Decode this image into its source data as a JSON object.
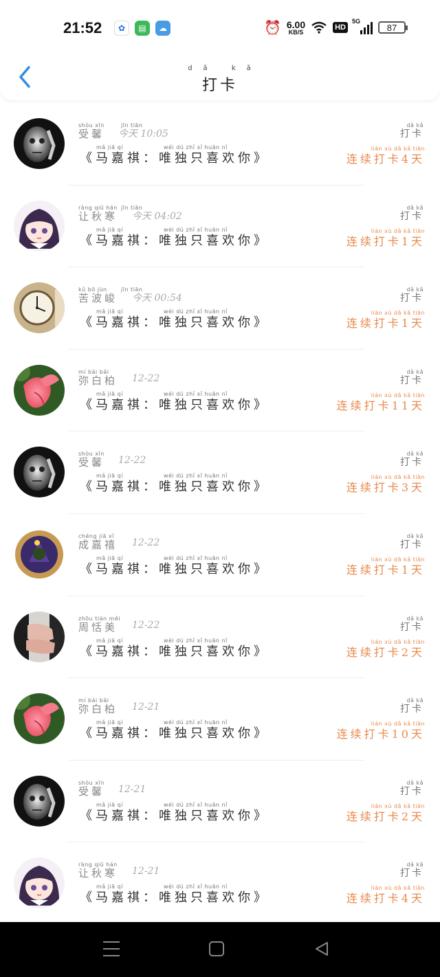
{
  "status_bar": {
    "time": "21:52",
    "net_speed_value": "6.00",
    "net_speed_unit": "KB/S",
    "hd": "HD",
    "network": "5G",
    "battery": "87"
  },
  "header": {
    "title": "打卡",
    "title_pinyin": "dǎ kǎ"
  },
  "labels": {
    "checkin_label": "打卡",
    "checkin_pinyin": "dǎ   kǎ",
    "post_pinyin_a": "mǎ  jiā  qí",
    "post_pinyin_b": "wéi  dú  zhǐ  xǐ  huān  nǐ",
    "streak_pinyin": "lián  xù  dǎ  kǎ  tiān"
  },
  "rows": [
    {
      "avatar": "skull-man",
      "name": "受馨",
      "name_pinyin": "shòu  xīn",
      "time": "今天 10:05",
      "time_pinyin": "jīn tiān",
      "post": "《马嘉祺：唯独只喜欢你》",
      "streak": "连续打卡4天"
    },
    {
      "avatar": "anime-girl",
      "name": "让秋寒",
      "name_pinyin": "ràng qiū hán",
      "time": "今天 04:02",
      "time_pinyin": "jīn tiān",
      "post": "《马嘉祺：唯独只喜欢你》",
      "streak": "连续打卡1天"
    },
    {
      "avatar": "clock",
      "name": "苦波峻",
      "name_pinyin": "kǔ  bō  jùn",
      "time": "今天 00:54",
      "time_pinyin": "jīn tiān",
      "post": "《马嘉祺：唯独只喜欢你》",
      "streak": "连续打卡1天"
    },
    {
      "avatar": "pink-flower",
      "name": "弥白柏",
      "name_pinyin": "mí  bái  bǎi",
      "time": "12-22",
      "time_pinyin": "",
      "post": "《马嘉祺：唯独只喜欢你》",
      "streak": "连续打卡11天"
    },
    {
      "avatar": "skull-man",
      "name": "受馨",
      "name_pinyin": "shòu  xīn",
      "time": "12-22",
      "time_pinyin": "",
      "post": "《马嘉祺：唯独只喜欢你》",
      "streak": "连续打卡3天"
    },
    {
      "avatar": "emblem",
      "name": "成嘉禧",
      "name_pinyin": "chéng jiā  xǐ",
      "time": "12-22",
      "time_pinyin": "",
      "post": "《马嘉祺：唯独只喜欢你》",
      "streak": "连续打卡1天"
    },
    {
      "avatar": "hand-photo",
      "name": "周恬美",
      "name_pinyin": "zhōu tián měi",
      "time": "12-22",
      "time_pinyin": "",
      "post": "《马嘉祺：唯独只喜欢你》",
      "streak": "连续打卡2天"
    },
    {
      "avatar": "pink-flower",
      "name": "弥白柏",
      "name_pinyin": "mí  bái  bǎi",
      "time": "12-21",
      "time_pinyin": "",
      "post": "《马嘉祺：唯独只喜欢你》",
      "streak": "连续打卡10天"
    },
    {
      "avatar": "skull-man",
      "name": "受馨",
      "name_pinyin": "shòu  xīn",
      "time": "12-21",
      "time_pinyin": "",
      "post": "《马嘉祺：唯独只喜欢你》",
      "streak": "连续打卡2天"
    },
    {
      "avatar": "anime-girl",
      "name": "让秋寒",
      "name_pinyin": "ràng qiū hán",
      "time": "12-21",
      "time_pinyin": "",
      "post": "《马嘉祺：唯独只喜欢你》",
      "streak": "连续打卡4天"
    }
  ],
  "colors": {
    "accent": "#e8894c",
    "back_arrow": "#2f8fe0",
    "navbar": "#000000"
  }
}
